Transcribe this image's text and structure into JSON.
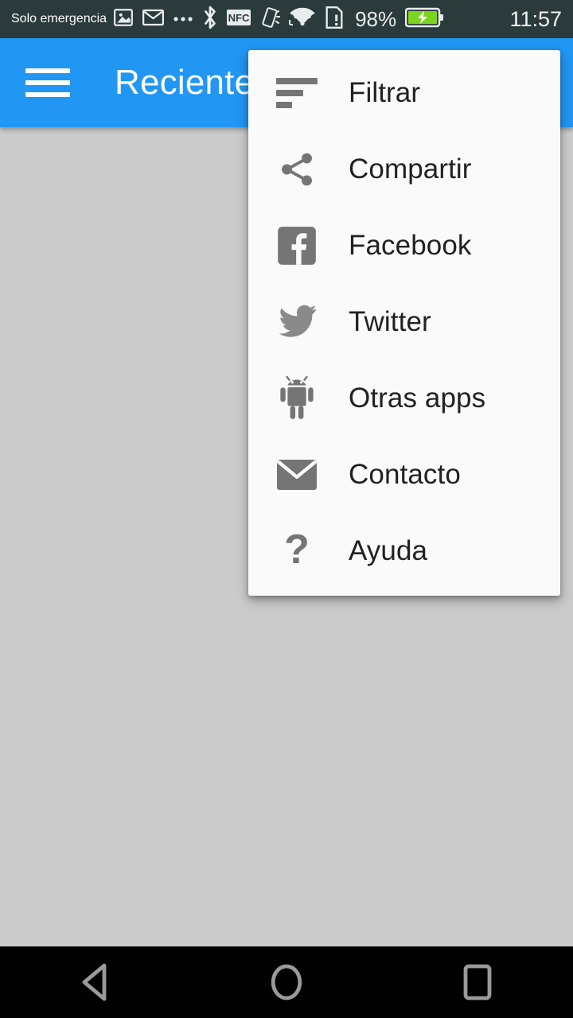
{
  "status_bar": {
    "carrier": "Solo emergencia",
    "battery_percent": "98%",
    "clock": "11:57",
    "background_color": "#2b3b3b",
    "text_color": "#f2f5f5",
    "icons": [
      "screenshot-icon",
      "email-icon",
      "more-notifications-icon",
      "bluetooth-icon",
      "nfc-icon",
      "vibrate-icon",
      "wifi-icon",
      "sim-alert-icon",
      "battery-charging-icon"
    ]
  },
  "app_bar": {
    "title": "Recientes",
    "menu_icon": "hamburger-icon",
    "background_color": "#2196f3",
    "title_color": "#ffffff"
  },
  "popup_menu": {
    "background_color": "#fafafa",
    "label_color": "#212121",
    "icon_color": "#757575",
    "items": [
      {
        "label": "Filtrar",
        "icon": "sort-filter-icon"
      },
      {
        "label": "Compartir",
        "icon": "share-icon"
      },
      {
        "label": "Facebook",
        "icon": "facebook-icon"
      },
      {
        "label": "Twitter",
        "icon": "twitter-icon"
      },
      {
        "label": "Otras apps",
        "icon": "android-robot-icon"
      },
      {
        "label": "Contacto",
        "icon": "envelope-icon"
      },
      {
        "label": "Ayuda",
        "icon": "question-mark-icon"
      }
    ]
  },
  "content": {
    "background_color": "#cbcbcb"
  },
  "nav_bar": {
    "background_color": "#000000",
    "icon_color": "#9a9a9a",
    "buttons": [
      {
        "name": "back",
        "icon": "back-triangle-icon"
      },
      {
        "name": "home",
        "icon": "home-circle-icon"
      },
      {
        "name": "recent",
        "icon": "recent-square-icon"
      }
    ]
  }
}
